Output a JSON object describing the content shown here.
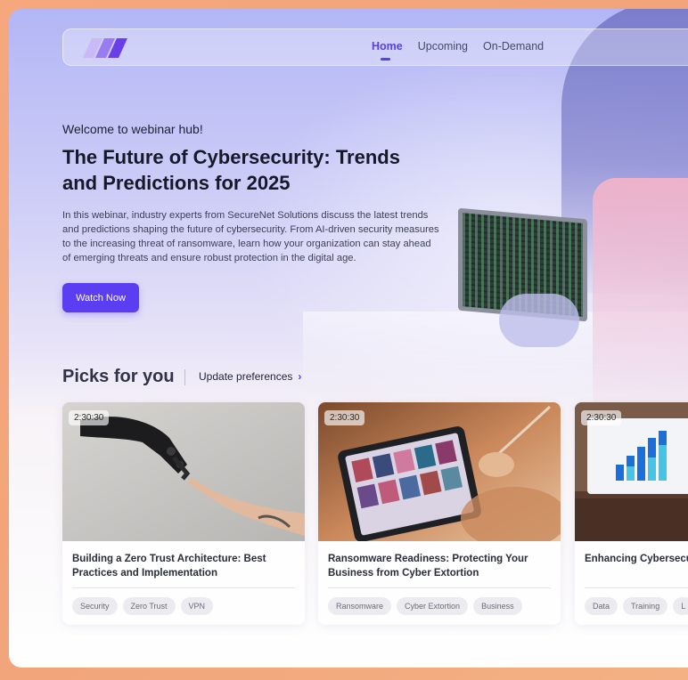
{
  "nav": {
    "logo": "logo",
    "links": [
      {
        "label": "Home",
        "active": true
      },
      {
        "label": "Upcoming",
        "active": false
      },
      {
        "label": "On-Demand",
        "active": false
      }
    ]
  },
  "hero": {
    "welcome": "Welcome to webinar hub!",
    "title": "The Future of Cybersecurity: Trends and Predictions for 2025",
    "description": "In this webinar, industry experts from SecureNet Solutions discuss the latest trends and predictions shaping the future of cybersecurity. From AI-driven security measures to the increasing threat of ransomware, learn how your organization can stay ahead of emerging threats and ensure robust protection in the digital age.",
    "cta": "Watch Now"
  },
  "picks": {
    "title": "Picks for you",
    "update_label": "Update preferences",
    "cards": [
      {
        "duration": "2:30:30",
        "title": "Building a Zero Trust Architecture: Best Practices and Implementation",
        "tags": [
          "Security",
          "Zero Trust",
          "VPN"
        ],
        "image": "robot-hand-touching-human-hand"
      },
      {
        "duration": "2:30:30",
        "title": "Ransomware Readiness: Protecting Your Business from Cyber Extortion",
        "tags": [
          "Ransomware",
          "Cyber Extortion",
          "Business"
        ],
        "image": "person-using-tablet"
      },
      {
        "duration": "2:30:30",
        "title": "Enhancing Cybersecuri Training",
        "tags": [
          "Data",
          "Training",
          "L"
        ],
        "image": "laptop-bar-chart"
      }
    ]
  },
  "colors": {
    "accent": "#5b3ef1",
    "frame": "#f6a77c"
  }
}
